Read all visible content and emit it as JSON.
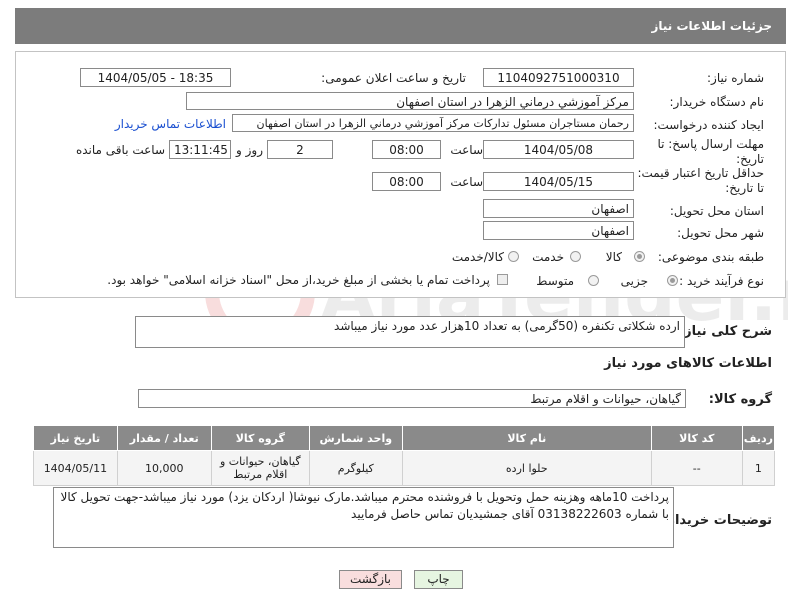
{
  "header": {
    "title": "جزئیات اطلاعات نیاز"
  },
  "form": {
    "need_number": {
      "label": "شماره نیاز:",
      "value": "1104092751000310"
    },
    "announce": {
      "label": "تاریخ و ساعت اعلان عمومی:",
      "value": "1404/05/05 - 18:35"
    },
    "buyer_org": {
      "label": "نام دستگاه خریدار:",
      "value": "مرکز آموزشي درماني الزهرا در استان اصفهان"
    },
    "requester": {
      "label": "ایجاد کننده درخواست:",
      "value": "رحمان مستاجران مسئول تدارکات مرکز آموزشي درماني الزهرا در استان اصفهان",
      "contact_link": "اطلاعات تماس خریدار"
    },
    "deadline": {
      "label": "مهلت ارسال پاسخ: تا تاریخ:",
      "date": "1404/05/08",
      "time_label": "ساعت",
      "time": "08:00",
      "days": "2",
      "days_label": "روز و",
      "remaining": "13:11:45",
      "remaining_label": "ساعت باقی مانده"
    },
    "validity": {
      "label": "حداقل تاریخ اعتبار قیمت: تا تاریخ:",
      "date": "1404/05/15",
      "time_label": "ساعت",
      "time": "08:00"
    },
    "province": {
      "label": "استان محل تحویل:",
      "value": "اصفهان"
    },
    "city": {
      "label": "شهر محل تحویل:",
      "value": "اصفهان"
    },
    "category": {
      "label": "طبقه بندی موضوعی:",
      "options": [
        "کالا",
        "خدمت",
        "کالا/خدمت"
      ],
      "selected": "کالا"
    },
    "process": {
      "label": "نوع فرآیند خرید :",
      "options": [
        "جزیی",
        "متوسط"
      ],
      "selected": "جزیی",
      "note": "پرداخت تمام یا بخشی از مبلغ خرید،از محل \"اسناد خزانه اسلامی\" خواهد بود."
    }
  },
  "description": {
    "label": "شرح کلی نیاز:",
    "value": "ارده شکلاتی تکنفره (50گرمی) به تعداد 10هزار عدد مورد نیاز میباشد"
  },
  "goods_section": {
    "title": "اطلاعات کالاهای مورد نیاز",
    "group_label": "گروه کالا:",
    "group_value": "گیاهان، حیوانات و اقلام مرتبط"
  },
  "table": {
    "headers": [
      "ردیف",
      "کد کالا",
      "نام کالا",
      "واحد شمارش",
      "گروه کالا",
      "تعداد / مقدار",
      "تاریخ نیاز"
    ],
    "rows": [
      [
        "1",
        "--",
        "حلوا ارده",
        "کیلوگرم",
        "گیاهان، حیوانات و اقلام مرتبط",
        "10,000",
        "1404/05/11"
      ]
    ]
  },
  "buyer_notes": {
    "label": "توضیحات خریدار:",
    "value": "پرداخت 10ماهه وهزینه حمل وتحویل با فروشنده محترم میباشد.مارک نیوشا( اردکان یزد) مورد نیاز میباشد-جهت تحویل کالا با شماره 03138222603 آقای جمشیدیان تماس حاصل فرمایید"
  },
  "buttons": {
    "print": "چاپ",
    "back": "بازگشت"
  },
  "watermark": {
    "text": "AriaTender.net"
  },
  "colors": {
    "header_bg": "#7c7c7c",
    "link": "#1a4fd0",
    "print_btn": "#e6f5e1",
    "back_btn": "#f9dede"
  }
}
